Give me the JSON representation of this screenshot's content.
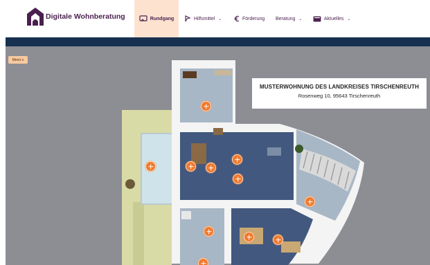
{
  "header": {
    "brand": "Digitale Wohnberatung",
    "nav": [
      {
        "label": "Rundgang",
        "icon": "tour-icon",
        "active": true,
        "dropdown": false
      },
      {
        "label": "Hilfsmittel",
        "icon": "aid-icon",
        "active": false,
        "dropdown": true
      },
      {
        "label": "Förderung",
        "icon": "euro-icon",
        "active": false,
        "dropdown": false
      },
      {
        "label": "Beratung",
        "icon": "",
        "active": false,
        "dropdown": true
      },
      {
        "label": "Aktuelles",
        "icon": "news-icon",
        "active": false,
        "dropdown": true
      }
    ],
    "caret": "⌄"
  },
  "tour": {
    "menu_button": "Menü ≡",
    "info_title": "MUSTERWOHNUNG DES LANDKREISES TIRSCHENREUTH",
    "info_address": "Rosenweg 10, 95643 Tirschenreuth",
    "hotspot_count": 12
  },
  "colors": {
    "brand_purple": "#4a1f4f",
    "accent_orange": "#f07a2f",
    "active_nav_bg": "#fde3cf",
    "bar_navy": "#17304f"
  }
}
